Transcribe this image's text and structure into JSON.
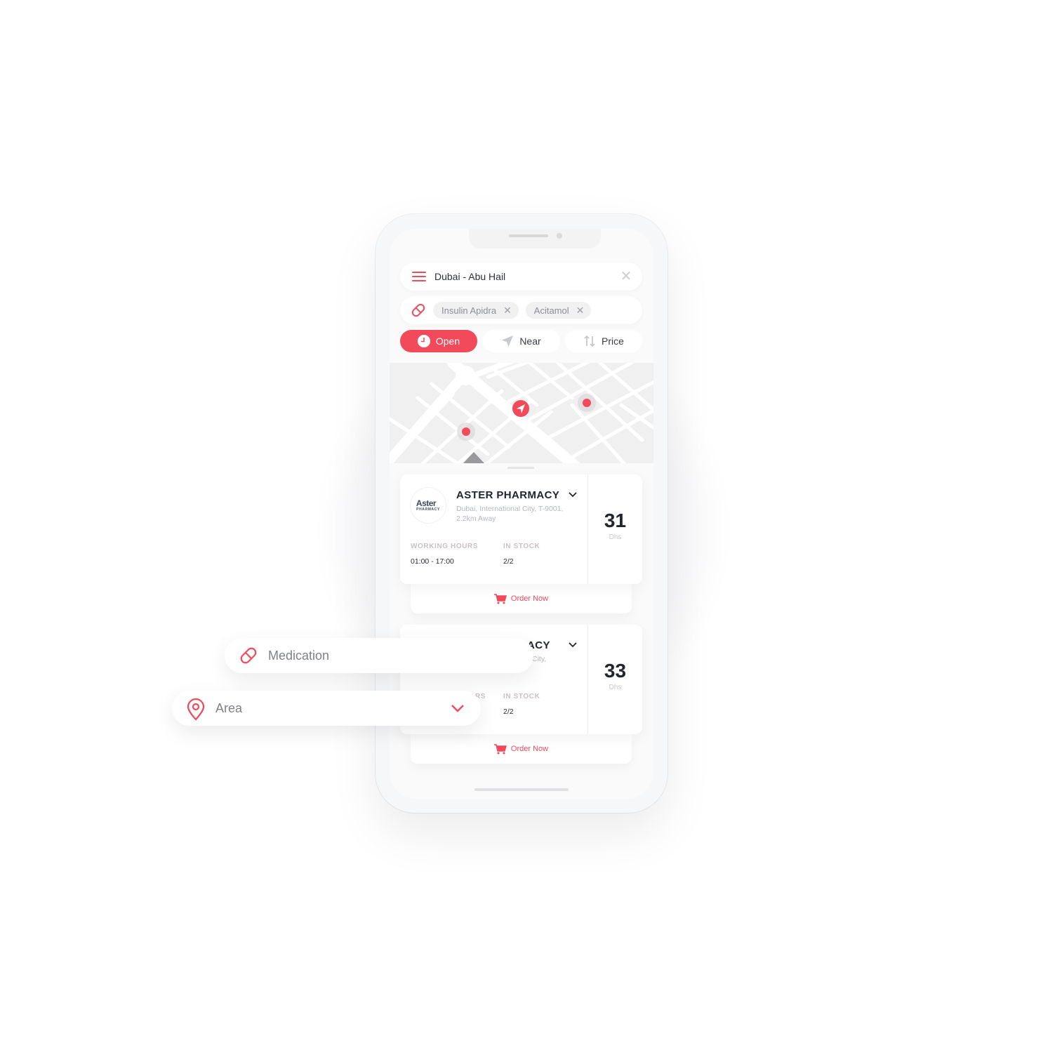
{
  "colors": {
    "accent": "#f24a5b",
    "text_dark": "#23252e",
    "text_muted": "#b6b8bd",
    "label": "#c9c2c5",
    "chip_bg": "#f1f1f2",
    "map_bg": "#f0f0f0"
  },
  "search": {
    "location_value": "Dubai - Abu Hail",
    "menu_icon": "hamburger-icon",
    "clear_icon": "close-icon",
    "medication_icon": "pill-icon",
    "medications": [
      {
        "label": "Insulin Apidra",
        "remove": "✕"
      },
      {
        "label": "Acitamol",
        "remove": "✕"
      }
    ]
  },
  "filters": [
    {
      "label": "Open",
      "icon": "clock-icon",
      "active": true
    },
    {
      "label": "Near",
      "icon": "navigation-arrow-icon",
      "active": false
    },
    {
      "label": "Price",
      "icon": "sort-arrows-icon",
      "active": false
    }
  ],
  "map": {
    "markers": [
      "pharmacy-marker",
      "current-location-marker",
      "pharmacy-marker"
    ]
  },
  "pharmacies": [
    {
      "logo_line1": "Aster",
      "logo_line2": "PHARMACY",
      "name": "ASTER PHARMACY",
      "address": "Dubai, International City, T-9001, 2.2km Away",
      "working_hours_label": "WORKING HOURS",
      "working_hours": "01:00 - 17:00",
      "stock_label": "IN STOCK",
      "stock": "2/2",
      "price": "31",
      "currency": "Dhs",
      "order_label": "Order Now"
    },
    {
      "name_partial": "ACY",
      "address_partial": "City,",
      "working_hours_label_partial": "RS",
      "stock_label": "IN STOCK",
      "stock": "2/2",
      "price": "33",
      "currency": "Dhs",
      "order_label": "Order Now"
    }
  ],
  "floating_fields": {
    "medication_placeholder": "Medication",
    "area_placeholder": "Area"
  }
}
